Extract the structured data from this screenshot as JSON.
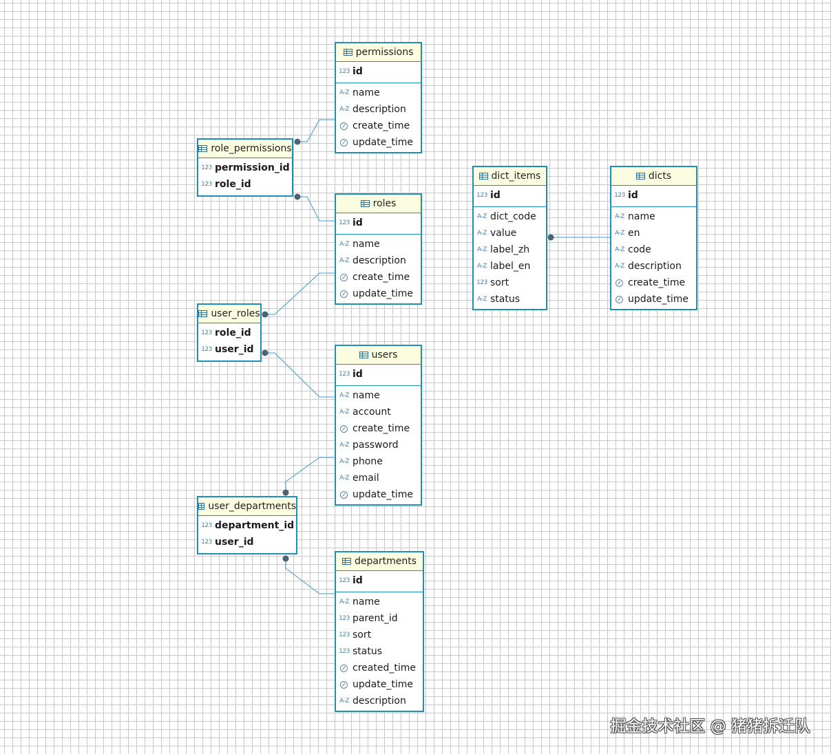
{
  "tables": [
    {
      "key": "permissions",
      "name": "permissions",
      "pk": [
        {
          "name": "id",
          "type": "123"
        }
      ],
      "fields": [
        {
          "name": "name",
          "type": "A-Z"
        },
        {
          "name": "description",
          "type": "A-Z"
        },
        {
          "name": "create_time",
          "type": "time"
        },
        {
          "name": "update_time",
          "type": "time"
        }
      ]
    },
    {
      "key": "role_permissions",
      "name": "role_permissions",
      "pk": [
        {
          "name": "permission_id",
          "type": "123"
        },
        {
          "name": "role_id",
          "type": "123"
        }
      ],
      "fields": []
    },
    {
      "key": "roles",
      "name": "roles",
      "pk": [
        {
          "name": "id",
          "type": "123"
        }
      ],
      "fields": [
        {
          "name": "name",
          "type": "A-Z"
        },
        {
          "name": "description",
          "type": "A-Z"
        },
        {
          "name": "create_time",
          "type": "time"
        },
        {
          "name": "update_time",
          "type": "time"
        }
      ]
    },
    {
      "key": "user_roles",
      "name": "user_roles",
      "pk": [
        {
          "name": "role_id",
          "type": "123"
        },
        {
          "name": "user_id",
          "type": "123"
        }
      ],
      "fields": []
    },
    {
      "key": "users",
      "name": "users",
      "pk": [
        {
          "name": "id",
          "type": "123"
        }
      ],
      "fields": [
        {
          "name": "name",
          "type": "A-Z"
        },
        {
          "name": "account",
          "type": "A-Z"
        },
        {
          "name": "create_time",
          "type": "time"
        },
        {
          "name": "password",
          "type": "A-Z"
        },
        {
          "name": "phone",
          "type": "A-Z"
        },
        {
          "name": "email",
          "type": "A-Z"
        },
        {
          "name": "update_time",
          "type": "time"
        }
      ]
    },
    {
      "key": "user_departments",
      "name": "user_departments",
      "pk": [
        {
          "name": "department_id",
          "type": "123"
        },
        {
          "name": "user_id",
          "type": "123"
        }
      ],
      "fields": []
    },
    {
      "key": "departments",
      "name": "departments",
      "pk": [
        {
          "name": "id",
          "type": "123"
        }
      ],
      "fields": [
        {
          "name": "name",
          "type": "A-Z"
        },
        {
          "name": "parent_id",
          "type": "123"
        },
        {
          "name": "sort",
          "type": "123"
        },
        {
          "name": "status",
          "type": "123"
        },
        {
          "name": "created_time",
          "type": "time"
        },
        {
          "name": "update_time",
          "type": "time"
        },
        {
          "name": "description",
          "type": "A-Z"
        }
      ]
    },
    {
      "key": "dict_items",
      "name": "dict_items",
      "pk": [
        {
          "name": "id",
          "type": "123"
        }
      ],
      "fields": [
        {
          "name": "dict_code",
          "type": "A-Z"
        },
        {
          "name": "value",
          "type": "A-Z"
        },
        {
          "name": "label_zh",
          "type": "A-Z"
        },
        {
          "name": "label_en",
          "type": "A-Z"
        },
        {
          "name": "sort",
          "type": "123"
        },
        {
          "name": "status",
          "type": "A-Z"
        }
      ]
    },
    {
      "key": "dicts",
      "name": "dicts",
      "pk": [
        {
          "name": "id",
          "type": "123"
        }
      ],
      "fields": [
        {
          "name": "name",
          "type": "A-Z"
        },
        {
          "name": "en",
          "type": "A-Z"
        },
        {
          "name": "code",
          "type": "A-Z"
        },
        {
          "name": "description",
          "type": "A-Z"
        },
        {
          "name": "create_time",
          "type": "time"
        },
        {
          "name": "update_time",
          "type": "time"
        }
      ]
    }
  ],
  "relations": [
    {
      "from": "role_permissions",
      "to": "permissions"
    },
    {
      "from": "role_permissions",
      "to": "roles"
    },
    {
      "from": "user_roles",
      "to": "roles"
    },
    {
      "from": "user_roles",
      "to": "users"
    },
    {
      "from": "user_departments",
      "to": "users"
    },
    {
      "from": "user_departments",
      "to": "departments"
    },
    {
      "from": "dict_items",
      "to": "dicts"
    }
  ],
  "colors": {
    "border": "#1e90b4",
    "header": "#fcfce0",
    "edge": "#3d9cc0",
    "dot": "#4a6272"
  },
  "watermark": "掘金技术社区 @ 猪猪拆迁队"
}
